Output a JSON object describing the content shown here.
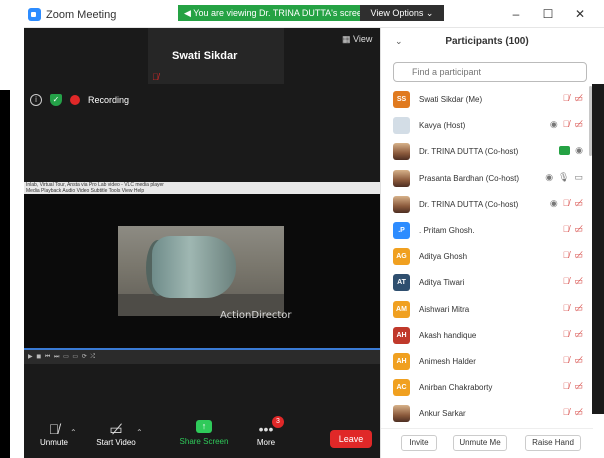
{
  "window": {
    "title": "Zoom Meeting",
    "banner": "You are viewing Dr. TRINA DUTTA's screen",
    "view_options": "View Options ⌄",
    "controls": [
      "–",
      "☐",
      "✕"
    ]
  },
  "meeting": {
    "active_speaker": "Swati Sikdar",
    "view_label": "▦ View",
    "recording_label": "Recording"
  },
  "shared_screen": {
    "player_title": "Inlab, Virtual Tour, Ansta via Pro Lab video - VLC media player",
    "player_menu": "Media  Playback  Audio  Video  Subtitle  Tools  View  Help",
    "watermark": "ActionDirector",
    "controls_glyphs": "▶ ◼ ⏮ ⏭ ▭ ▭ ⟳ ⤮"
  },
  "toolbar": {
    "unmute": "Unmute",
    "start_video": "Start Video",
    "share_screen": "Share Screen",
    "more": "More",
    "more_badge": "3",
    "leave": "Leave"
  },
  "participants": {
    "title": "Participants (100)",
    "search_placeholder": "Find a participant",
    "rows": [
      {
        "name": "Swati Sikdar (Me)",
        "avatar": "SS",
        "color": "#e07a1f",
        "icons": "muted"
      },
      {
        "name": "Kavya (Host)",
        "avatar": "",
        "color": "#d3dde6",
        "icons": "rec-muted"
      },
      {
        "name": "Dr. TRINA DUTTA (Co-host)",
        "avatar": "",
        "color": "",
        "icons": "share-rec"
      },
      {
        "name": "Prasanta Bardhan (Co-host)",
        "avatar": "",
        "color": "",
        "icons": "rec-mic-cam"
      },
      {
        "name": "Dr. TRINA DUTTA (Co-host)",
        "avatar": "",
        "color": "",
        "icons": "rec-muted"
      },
      {
        "name": ". Pritam Ghosh.",
        "avatar": ".P",
        "color": "#2d8cff",
        "icons": "muted"
      },
      {
        "name": "Aditya Ghosh",
        "avatar": "AG",
        "color": "#f0a020",
        "icons": "muted"
      },
      {
        "name": "Aditya Tiwari",
        "avatar": "AT",
        "color": "#2f4f6f",
        "icons": "muted"
      },
      {
        "name": "Aishwari Mitra",
        "avatar": "AM",
        "color": "#f0a020",
        "icons": "muted"
      },
      {
        "name": "Akash handique",
        "avatar": "AH",
        "color": "#c0392b",
        "icons": "muted"
      },
      {
        "name": "Animesh Halder",
        "avatar": "AH",
        "color": "#f0a020",
        "icons": "muted"
      },
      {
        "name": "Anirban Chakraborty",
        "avatar": "AC",
        "color": "#f0a020",
        "icons": "muted"
      },
      {
        "name": "Ankur Sarkar",
        "avatar": "",
        "color": "",
        "icons": "muted"
      }
    ],
    "footer": {
      "invite": "Invite",
      "unmute_me": "Unmute Me",
      "raise_hand": "Raise Hand"
    }
  }
}
